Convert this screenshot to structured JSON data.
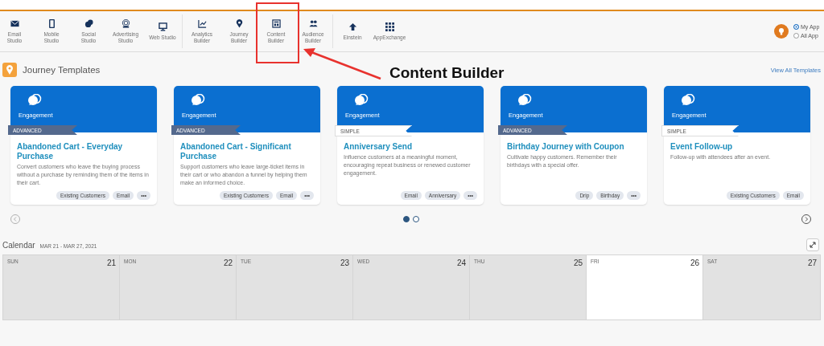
{
  "toolbar": {
    "groups": [
      [
        {
          "label": "Email Studio"
        },
        {
          "label": "Mobile Studio"
        },
        {
          "label": "Social Studio"
        },
        {
          "label": "Advertising Studio"
        },
        {
          "label": "Web Studio"
        }
      ],
      [
        {
          "label": "Analytics Builder"
        },
        {
          "label": "Journey Builder"
        },
        {
          "label": "Content Builder"
        },
        {
          "label": "Audience Builder"
        }
      ],
      [
        {
          "label": "Einstein"
        },
        {
          "label": "AppExchange"
        }
      ]
    ],
    "app_filter": [
      {
        "label": "My App",
        "selected": true
      },
      {
        "label": "All App",
        "selected": false
      }
    ]
  },
  "annotation": {
    "label": "Content Builder"
  },
  "journey_templates": {
    "title": "Journey Templates",
    "view_all": "View All Templates",
    "cards": [
      {
        "category": "Engagement",
        "level": "ADVANCED",
        "kind": "advanced",
        "title": "Abandoned Cart - Everyday Purchase",
        "description": "Convert customers who leave the buying process without a purchase by reminding them of the items in their cart.",
        "tags": [
          "Existing Customers",
          "Email",
          "•••"
        ]
      },
      {
        "category": "Engagement",
        "level": "ADVANCED",
        "kind": "advanced",
        "title": "Abandoned Cart - Significant Purchase",
        "description": "Support customers who leave large-ticket items in their cart or who abandon a funnel by helping them make an informed choice.",
        "tags": [
          "Existing Customers",
          "Email",
          "•••"
        ]
      },
      {
        "category": "Engagement",
        "level": "SIMPLE",
        "kind": "simple",
        "title": "Anniversary Send",
        "description": "Influence customers at a meaningful moment, encouraging repeat business or renewed customer engagement.",
        "tags": [
          "Email",
          "Anniversary",
          "•••"
        ]
      },
      {
        "category": "Engagement",
        "level": "ADVANCED",
        "kind": "advanced",
        "title": "Birthday Journey with Coupon",
        "description": "Cultivate happy customers. Remember their birthdays with a special offer.",
        "tags": [
          "Drip",
          "Birthday",
          "•••"
        ]
      },
      {
        "category": "Engagement",
        "level": "SIMPLE",
        "kind": "simple",
        "title": "Event Follow-up",
        "description": "Follow-up with attendees after an event.",
        "tags": [
          "Existing Customers",
          "Email"
        ]
      }
    ],
    "pages": [
      {
        "selected": true
      },
      {
        "selected": false
      }
    ]
  },
  "calendar": {
    "title": "Calendar",
    "range": "MAR 21 - MAR 27, 2021",
    "days": [
      {
        "name": "SUN",
        "date": "21",
        "selected": false
      },
      {
        "name": "MON",
        "date": "22",
        "selected": false
      },
      {
        "name": "TUE",
        "date": "23",
        "selected": false
      },
      {
        "name": "WED",
        "date": "24",
        "selected": false
      },
      {
        "name": "THU",
        "date": "25",
        "selected": false
      },
      {
        "name": "FRI",
        "date": "26",
        "selected": true
      },
      {
        "name": "SAT",
        "date": "27",
        "selected": false
      }
    ]
  }
}
